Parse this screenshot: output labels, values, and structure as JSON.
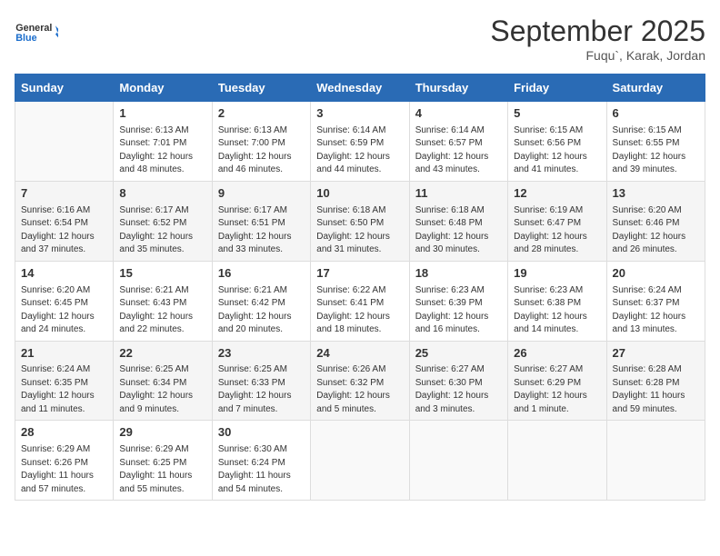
{
  "header": {
    "logo_general": "General",
    "logo_blue": "Blue",
    "month_title": "September 2025",
    "location": "Fuqu`, Karak, Jordan"
  },
  "days_of_week": [
    "Sunday",
    "Monday",
    "Tuesday",
    "Wednesday",
    "Thursday",
    "Friday",
    "Saturday"
  ],
  "weeks": [
    [
      {
        "day": "",
        "info": ""
      },
      {
        "day": "1",
        "info": "Sunrise: 6:13 AM\nSunset: 7:01 PM\nDaylight: 12 hours and 48 minutes."
      },
      {
        "day": "2",
        "info": "Sunrise: 6:13 AM\nSunset: 7:00 PM\nDaylight: 12 hours and 46 minutes."
      },
      {
        "day": "3",
        "info": "Sunrise: 6:14 AM\nSunset: 6:59 PM\nDaylight: 12 hours and 44 minutes."
      },
      {
        "day": "4",
        "info": "Sunrise: 6:14 AM\nSunset: 6:57 PM\nDaylight: 12 hours and 43 minutes."
      },
      {
        "day": "5",
        "info": "Sunrise: 6:15 AM\nSunset: 6:56 PM\nDaylight: 12 hours and 41 minutes."
      },
      {
        "day": "6",
        "info": "Sunrise: 6:15 AM\nSunset: 6:55 PM\nDaylight: 12 hours and 39 minutes."
      }
    ],
    [
      {
        "day": "7",
        "info": "Sunrise: 6:16 AM\nSunset: 6:54 PM\nDaylight: 12 hours and 37 minutes."
      },
      {
        "day": "8",
        "info": "Sunrise: 6:17 AM\nSunset: 6:52 PM\nDaylight: 12 hours and 35 minutes."
      },
      {
        "day": "9",
        "info": "Sunrise: 6:17 AM\nSunset: 6:51 PM\nDaylight: 12 hours and 33 minutes."
      },
      {
        "day": "10",
        "info": "Sunrise: 6:18 AM\nSunset: 6:50 PM\nDaylight: 12 hours and 31 minutes."
      },
      {
        "day": "11",
        "info": "Sunrise: 6:18 AM\nSunset: 6:48 PM\nDaylight: 12 hours and 30 minutes."
      },
      {
        "day": "12",
        "info": "Sunrise: 6:19 AM\nSunset: 6:47 PM\nDaylight: 12 hours and 28 minutes."
      },
      {
        "day": "13",
        "info": "Sunrise: 6:20 AM\nSunset: 6:46 PM\nDaylight: 12 hours and 26 minutes."
      }
    ],
    [
      {
        "day": "14",
        "info": "Sunrise: 6:20 AM\nSunset: 6:45 PM\nDaylight: 12 hours and 24 minutes."
      },
      {
        "day": "15",
        "info": "Sunrise: 6:21 AM\nSunset: 6:43 PM\nDaylight: 12 hours and 22 minutes."
      },
      {
        "day": "16",
        "info": "Sunrise: 6:21 AM\nSunset: 6:42 PM\nDaylight: 12 hours and 20 minutes."
      },
      {
        "day": "17",
        "info": "Sunrise: 6:22 AM\nSunset: 6:41 PM\nDaylight: 12 hours and 18 minutes."
      },
      {
        "day": "18",
        "info": "Sunrise: 6:23 AM\nSunset: 6:39 PM\nDaylight: 12 hours and 16 minutes."
      },
      {
        "day": "19",
        "info": "Sunrise: 6:23 AM\nSunset: 6:38 PM\nDaylight: 12 hours and 14 minutes."
      },
      {
        "day": "20",
        "info": "Sunrise: 6:24 AM\nSunset: 6:37 PM\nDaylight: 12 hours and 13 minutes."
      }
    ],
    [
      {
        "day": "21",
        "info": "Sunrise: 6:24 AM\nSunset: 6:35 PM\nDaylight: 12 hours and 11 minutes."
      },
      {
        "day": "22",
        "info": "Sunrise: 6:25 AM\nSunset: 6:34 PM\nDaylight: 12 hours and 9 minutes."
      },
      {
        "day": "23",
        "info": "Sunrise: 6:25 AM\nSunset: 6:33 PM\nDaylight: 12 hours and 7 minutes."
      },
      {
        "day": "24",
        "info": "Sunrise: 6:26 AM\nSunset: 6:32 PM\nDaylight: 12 hours and 5 minutes."
      },
      {
        "day": "25",
        "info": "Sunrise: 6:27 AM\nSunset: 6:30 PM\nDaylight: 12 hours and 3 minutes."
      },
      {
        "day": "26",
        "info": "Sunrise: 6:27 AM\nSunset: 6:29 PM\nDaylight: 12 hours and 1 minute."
      },
      {
        "day": "27",
        "info": "Sunrise: 6:28 AM\nSunset: 6:28 PM\nDaylight: 11 hours and 59 minutes."
      }
    ],
    [
      {
        "day": "28",
        "info": "Sunrise: 6:29 AM\nSunset: 6:26 PM\nDaylight: 11 hours and 57 minutes."
      },
      {
        "day": "29",
        "info": "Sunrise: 6:29 AM\nSunset: 6:25 PM\nDaylight: 11 hours and 55 minutes."
      },
      {
        "day": "30",
        "info": "Sunrise: 6:30 AM\nSunset: 6:24 PM\nDaylight: 11 hours and 54 minutes."
      },
      {
        "day": "",
        "info": ""
      },
      {
        "day": "",
        "info": ""
      },
      {
        "day": "",
        "info": ""
      },
      {
        "day": "",
        "info": ""
      }
    ]
  ]
}
